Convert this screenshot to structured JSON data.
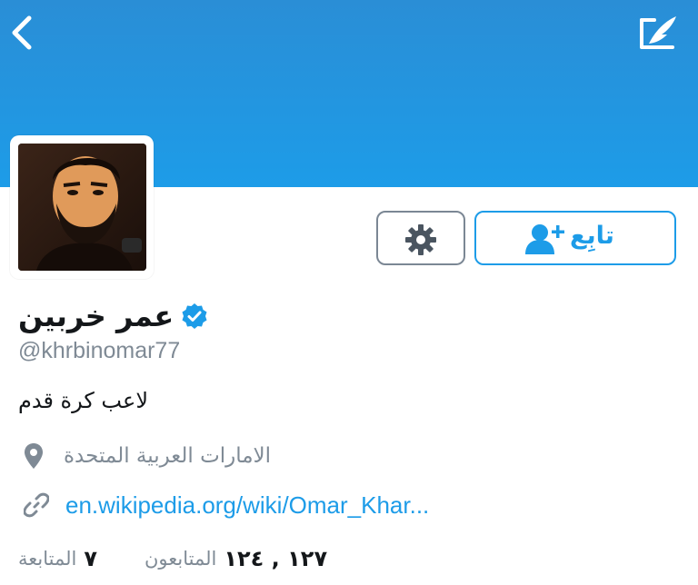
{
  "header": {
    "back_icon": "chevron-left-icon",
    "compose_icon": "compose-tweet-icon",
    "banner_color": "#1d9ce8"
  },
  "profile": {
    "display_name": "عمر خربين",
    "verified": true,
    "handle": "@khrbinomar77",
    "bio": "لاعب كرة قدم",
    "location": "الامارات العربية المتحدة",
    "website": "en.wikipedia.org/wiki/Omar_Khar..."
  },
  "actions": {
    "settings_icon": "gear-icon",
    "follow_label": "تابِع",
    "follow_icon": "add-user-icon"
  },
  "stats": {
    "followers_count": "١٢٧ , ١٢٤",
    "followers_label": "المتابعون",
    "following_count": "٧",
    "following_label": "المتابعة"
  },
  "colors": {
    "accent": "#1d9ce8",
    "muted": "#7f8a95",
    "text": "#14171a",
    "border": "#7b8794"
  }
}
